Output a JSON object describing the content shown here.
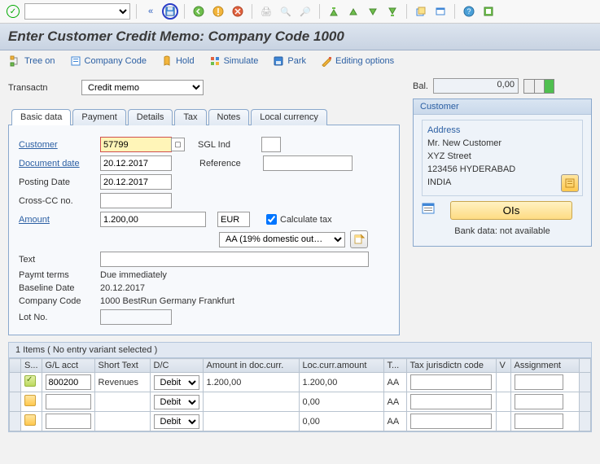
{
  "toolbar": {
    "ok_tooltip": "Enter",
    "save_tooltip": "Save"
  },
  "title": "Enter Customer Credit Memo: Company Code 1000",
  "menu": {
    "tree_on": "Tree on",
    "company_code": "Company Code",
    "hold": "Hold",
    "simulate": "Simulate",
    "park": "Park",
    "editing_options": "Editing options"
  },
  "transaction": {
    "label": "Transactn",
    "value": "Credit memo"
  },
  "balance": {
    "label": "Bal.",
    "value": "0,00"
  },
  "customer_box": {
    "title": "Customer",
    "address_label": "Address",
    "lines": [
      "Mr. New Customer",
      "XYZ Street",
      "123456 HYDERABAD",
      "INDIA"
    ],
    "ois": "OIs",
    "bank_data": "Bank data: not available"
  },
  "tabs": [
    "Basic data",
    "Payment",
    "Details",
    "Tax",
    "Notes",
    "Local currency"
  ],
  "basic": {
    "customer_label": "Customer",
    "customer_value": "57799",
    "sgl_ind_label": "SGL Ind",
    "sgl_ind_value": "",
    "doc_date_label": "Document date",
    "doc_date_value": "20.12.2017",
    "reference_label": "Reference",
    "reference_value": "",
    "posting_date_label": "Posting Date",
    "posting_date_value": "20.12.2017",
    "cross_cc_label": "Cross-CC no.",
    "cross_cc_value": "",
    "amount_label": "Amount",
    "amount_value": "1.200,00",
    "currency": "EUR",
    "calc_tax_label": "Calculate tax",
    "tax_code": "AA (19% domestic out…",
    "text_label": "Text",
    "text_value": "",
    "paymt_terms_label": "Paymt terms",
    "paymt_terms_value": "Due immediately",
    "baseline_date_label": "Baseline Date",
    "baseline_date_value": "20.12.2017",
    "company_code_label": "Company Code",
    "company_code_value": "1000 BestRun Germany Frankfurt",
    "lot_no_label": "Lot No.",
    "lot_no_value": ""
  },
  "items_header": "1 Items ( No entry variant selected )",
  "grid": {
    "cols": [
      "S...",
      "G/L acct",
      "Short Text",
      "D/C",
      "Amount in doc.curr.",
      "Loc.curr.amount",
      "T...",
      "Tax jurisdictn code",
      "V",
      "Assignment"
    ],
    "rows": [
      {
        "status": "ok",
        "gl": "800200",
        "short": "Revenues",
        "dc": "Debit",
        "amt": "1.200,00",
        "loc": "1.200,00",
        "tax": "AA",
        "jur": "",
        "v": "",
        "assign": ""
      },
      {
        "status": "warn",
        "gl": "",
        "short": "",
        "dc": "Debit",
        "amt": "",
        "loc": "0,00",
        "tax": "AA",
        "jur": "",
        "v": "",
        "assign": ""
      },
      {
        "status": "warn",
        "gl": "",
        "short": "",
        "dc": "Debit",
        "amt": "",
        "loc": "0,00",
        "tax": "AA",
        "jur": "",
        "v": "",
        "assign": ""
      }
    ]
  }
}
